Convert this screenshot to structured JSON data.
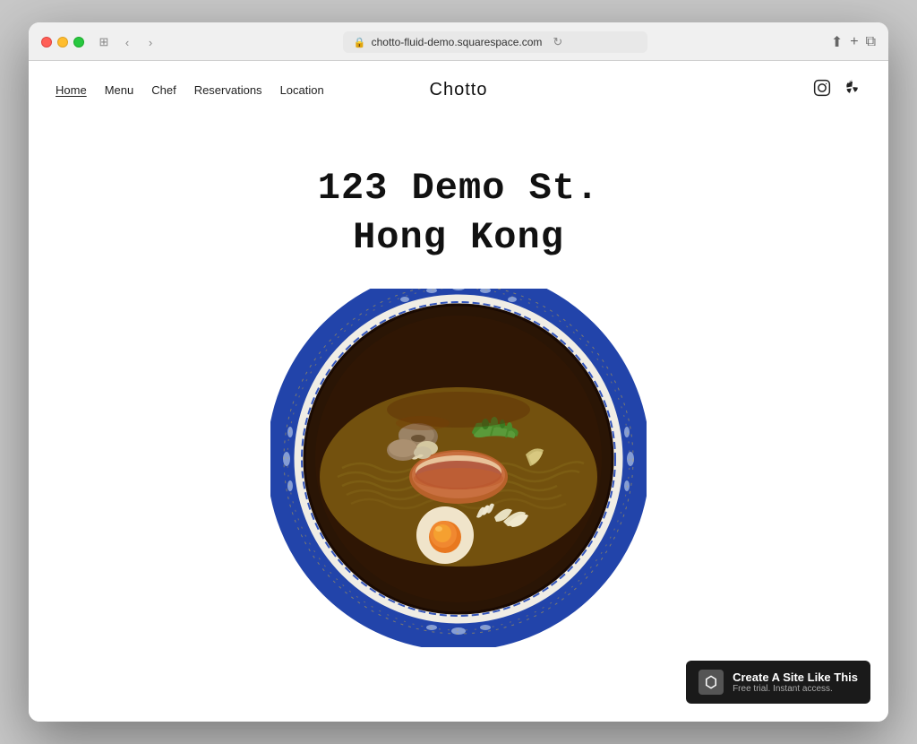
{
  "browser": {
    "url": "chotto-fluid-demo.squarespace.com",
    "traffic_lights": [
      "red",
      "yellow",
      "green"
    ],
    "back_label": "‹",
    "forward_label": "›",
    "sidebar_label": "⊞",
    "refresh_label": "↻",
    "share_label": "⬆",
    "new_tab_label": "+",
    "windows_label": "⧉"
  },
  "nav": {
    "links": [
      {
        "label": "Home",
        "active": true
      },
      {
        "label": "Menu",
        "active": false
      },
      {
        "label": "Chef",
        "active": false
      },
      {
        "label": "Reservations",
        "active": false
      },
      {
        "label": "Location",
        "active": false
      }
    ],
    "logo": "Chotto",
    "social": [
      {
        "label": "instagram-icon",
        "symbol": "◻"
      },
      {
        "label": "yelp-icon",
        "symbol": "✿"
      }
    ]
  },
  "hero": {
    "line1": "123 Demo St.",
    "line2": "Hong Kong"
  },
  "badge": {
    "main_text": "Create A Site Like This",
    "sub_text": "Free trial. Instant access.",
    "icon_label": "squarespace-logo"
  }
}
